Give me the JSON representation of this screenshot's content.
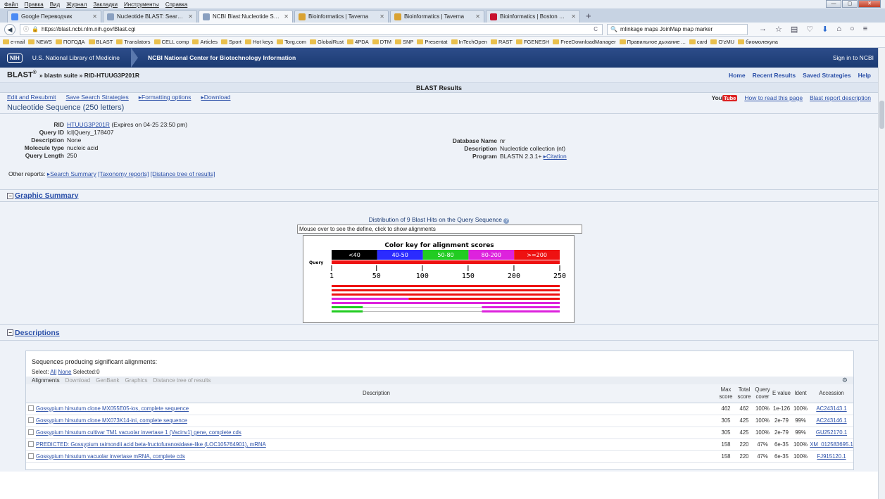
{
  "browser": {
    "menu": [
      "Файл",
      "Правка",
      "Вид",
      "Журнал",
      "Закладки",
      "Инструменты",
      "Справка"
    ],
    "tabs": [
      {
        "label": "Google Переводчик",
        "favicon_color": "#4a8af4",
        "active": false
      },
      {
        "label": "Nucleotide BLAST: Search ...",
        "favicon_color": "#8aa0c0",
        "active": false
      },
      {
        "label": "NCBI Blast:Nucleotide Seq...",
        "favicon_color": "#8aa0c0",
        "active": true
      },
      {
        "label": "Bioinformatics | Taverna",
        "favicon_color": "#d9a233",
        "active": false
      },
      {
        "label": "Bioinformatics | Taverna",
        "favicon_color": "#d9a233",
        "active": false
      },
      {
        "label": "Bioinformatics | Boston Un...",
        "favicon_color": "#c8102e",
        "active": false
      }
    ],
    "url": "https://blast.ncbi.nlm.nih.gov/Blast.cgi",
    "search_value": "mlinkage maps JoinMap map marker",
    "bookmarks": [
      "e-mail",
      "NEWS",
      "ПОГОДА",
      "BLAST",
      "Translators",
      "CELL comp",
      "Articles",
      "Sport",
      "Hot keys",
      "Torg.com",
      "GlobalRust",
      "4PDA",
      "DTM",
      "SNP",
      "Presentat",
      "InTechOpen",
      "RAST",
      "FGENESH",
      "FreeDownloadManager",
      "Правильное дыхание ...",
      "card",
      "O'zMU",
      "биомолекула"
    ]
  },
  "ncbi": {
    "nih": "NIH",
    "nlm": "U.S. National Library of Medicine",
    "ncbi_title": "NCBI  National Center for Biotechnology Information",
    "sign_in": "Sign in to NCBI",
    "blast": "BLAST",
    "reg": "®",
    "breadcrumb": "» blastn suite » RID-HTUUG3P201R",
    "top_links": [
      "Home",
      "Recent Results",
      "Saved Strategies",
      "Help"
    ],
    "results_title": "BLAST Results",
    "actions": [
      "Edit and Resubmit",
      "Save Search Strategies",
      "▸Formatting options",
      "▸Download"
    ],
    "how_to_read": "How to read this page",
    "report_desc": "Blast report description",
    "youtube": [
      "You",
      "Tube"
    ],
    "seq_title": "Nucleotide Sequence (250 letters)"
  },
  "info": {
    "rid_label": "RID",
    "rid": "HTUUG3P201R",
    "rid_expires": "(Expires on 04-25 23:50 pm)",
    "left": [
      {
        "k": "Query ID",
        "v": "lcl|Query_178407"
      },
      {
        "k": "Description",
        "v": "None"
      },
      {
        "k": "Molecule type",
        "v": "nucleic acid"
      },
      {
        "k": "Query Length",
        "v": "250"
      }
    ],
    "right": [
      {
        "k": "Database Name",
        "v": "nr"
      },
      {
        "k": "Description",
        "v": "Nucleotide collection (nt)"
      },
      {
        "k": "Program",
        "v": "BLASTN 2.3.1+",
        "link": "▸Citation"
      }
    ],
    "other_label": "Other reports:",
    "other_links": [
      "▸Search Summary",
      "[Taxonomy reports]",
      "[Distance tree of results]"
    ]
  },
  "graphic": {
    "section": "Graphic Summary",
    "title": "Distribution of 9 Blast Hits on the Query Sequence",
    "mouseover": "Mouse over to see the define, click to show alignments",
    "key_title": "Color key for alignment scores",
    "key": [
      {
        "label": "<40",
        "color": "#000000"
      },
      {
        "label": "40-50",
        "color": "#2b2bff"
      },
      {
        "label": "50-80",
        "color": "#22cc22"
      },
      {
        "label": "80-200",
        "color": "#dd22dd"
      },
      {
        "label": ">=200",
        "color": "#ee1111"
      }
    ],
    "query_label": "Query",
    "ticks": [
      "1",
      "50",
      "100",
      "150",
      "200",
      "250"
    ],
    "query_length": 250,
    "hits": [
      {
        "segments": [
          {
            "from": 1,
            "to": 250,
            "color": "#ee1111"
          }
        ]
      },
      {
        "segments": [
          {
            "from": 1,
            "to": 250,
            "color": "#ee1111"
          }
        ]
      },
      {
        "segments": [
          {
            "from": 1,
            "to": 250,
            "color": "#ee1111"
          }
        ]
      },
      {
        "segments": [
          {
            "from": 1,
            "to": 85,
            "color": "#dd22dd"
          },
          {
            "from": 85,
            "to": 250,
            "color": "#ee1111"
          }
        ]
      },
      {
        "segments": [
          {
            "from": 1,
            "to": 250,
            "color": "#dd22dd"
          }
        ]
      },
      {
        "segments": [
          {
            "from": 1,
            "to": 35,
            "color": "#22cc22"
          },
          {
            "from": 35,
            "to": 165,
            "color": "#bbbbbb",
            "thin": true
          },
          {
            "from": 165,
            "to": 250,
            "color": "#dd22dd"
          }
        ]
      },
      {
        "segments": [
          {
            "from": 1,
            "to": 35,
            "color": "#22cc22"
          },
          {
            "from": 35,
            "to": 165,
            "color": "#bbbbbb",
            "thin": true
          },
          {
            "from": 165,
            "to": 250,
            "color": "#dd22dd"
          }
        ]
      }
    ]
  },
  "descriptions": {
    "section": "Descriptions",
    "heading": "Sequences producing significant alignments:",
    "select_label": "Select:",
    "all": "All",
    "none": "None",
    "selected": "Selected:0",
    "toolbar": [
      "Alignments",
      "Download",
      "GenBank",
      "Graphics",
      "Distance tree of results"
    ],
    "columns": [
      "Description",
      "Max score",
      "Total score",
      "Query cover",
      "E value",
      "Ident",
      "Accession"
    ],
    "rows": [
      [
        "Gossypium hirsutum clone MX055E05-ios, complete sequence",
        "462",
        "462",
        "100%",
        "1e-126",
        "100%",
        "AC243143.1"
      ],
      [
        "Gossypium hirsutum clone MX073K14-ini, complete sequence",
        "305",
        "425",
        "100%",
        "2e-79",
        "99%",
        "AC243146.1"
      ],
      [
        "Gossypium hirsutum cultivar TM1 vacuolar invertase 1 (Vacinv1) gene, complete cds",
        "305",
        "425",
        "100%",
        "2e-79",
        "99%",
        "GU252170.1"
      ],
      [
        "PREDICTED: Gossypium raimondii acid beta-fructofuranosidase-like (LOC105764901), mRNA",
        "158",
        "220",
        "47%",
        "6e-35",
        "100%",
        "XM_012583695.1"
      ],
      [
        "Gossypium hirsutum vacuolar invertase mRNA, complete cds",
        "158",
        "220",
        "47%",
        "6e-35",
        "100%",
        "FJ915120.1"
      ]
    ]
  }
}
